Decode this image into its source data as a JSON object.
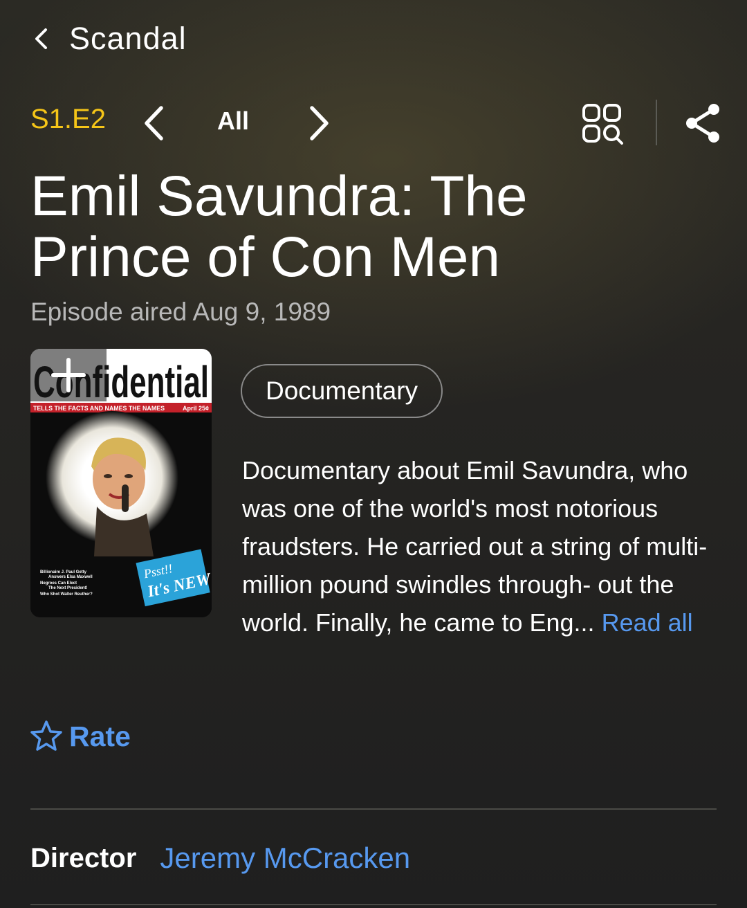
{
  "header": {
    "back_title": "Scandal"
  },
  "episode_nav": {
    "episode_label": "S1.E2",
    "all_label": "All"
  },
  "title": {
    "line1": "Emil Savundra: The",
    "line2": "Prince of Con Men"
  },
  "aired": "Episode aired Aug 9, 1989",
  "poster": {
    "masthead": "Confidential",
    "strap": "TELLS THE FACTS AND NAMES THE NAMES",
    "price": "April 25¢",
    "badge_line1": "Psst!!",
    "badge_line2": "It's NEW",
    "headlines": [
      "Billionaire J. Paul Getty",
      "Answers Elsa Maxwell",
      "Negroes Can Elect",
      "The Next President!",
      "Who Shot Walter Reuther?"
    ]
  },
  "genre": "Documentary",
  "plot": {
    "text": "Documentary about Emil Savundra, who was one of the world's most notorious fraudsters. He carried out a string of multi-million pound swindles through- out the world. Finally, he came to Eng...",
    "read_all": "Read all"
  },
  "rate": {
    "label": "Rate"
  },
  "director": {
    "label": "Director",
    "name": "Jeremy McCracken"
  },
  "colors": {
    "accent_yellow": "#f5c518",
    "link_blue": "#5799ef",
    "background": "#1f1f1f"
  },
  "icons": {
    "back": "chevron-left-icon",
    "prev": "chevron-left-icon",
    "next": "chevron-right-icon",
    "episodes_grid": "grid-search-icon",
    "share": "share-icon",
    "add": "plus-icon",
    "rate": "star-outline-icon"
  }
}
